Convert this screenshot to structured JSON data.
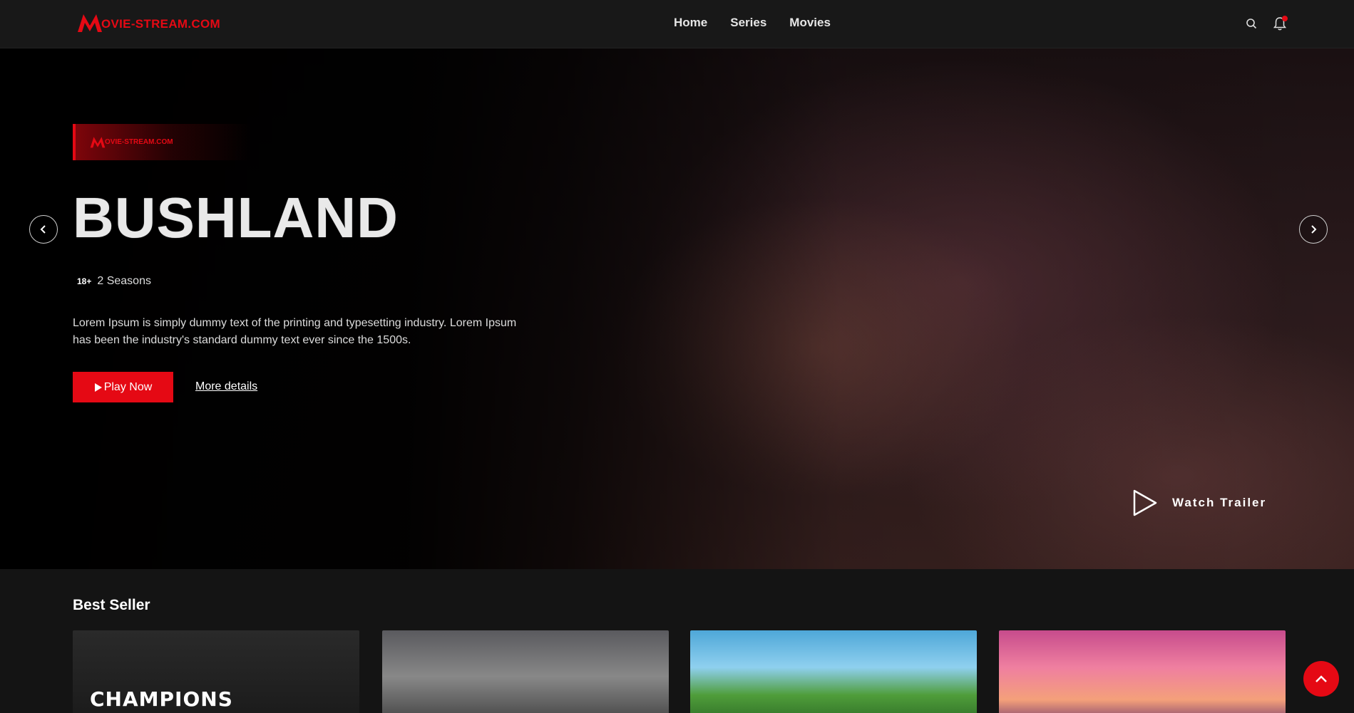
{
  "brand": {
    "name": "OVIE-STREAM.COM",
    "color": "#e50914"
  },
  "nav": {
    "links": [
      {
        "label": "Home"
      },
      {
        "label": "Series"
      },
      {
        "label": "Movies"
      }
    ],
    "icons": [
      "search-icon",
      "bell-icon"
    ]
  },
  "hero": {
    "badge_text": "OVIE-STREAM.COM",
    "title": "BUSHLAND",
    "rating": "18+",
    "seasons": "2 Seasons",
    "description": "Lorem Ipsum is simply dummy text of the printing and typesetting industry. Lorem Ipsum has been the industry's standard dummy text ever since the 1500s.",
    "play_label": "Play Now",
    "more_label": "More details",
    "trailer_label": "Watch Trailer"
  },
  "best_seller": {
    "title": "Best Seller",
    "cards": [
      {
        "caption": "CHAMPIONS"
      },
      {
        "caption": ""
      },
      {
        "caption": ""
      },
      {
        "caption": ""
      }
    ]
  }
}
